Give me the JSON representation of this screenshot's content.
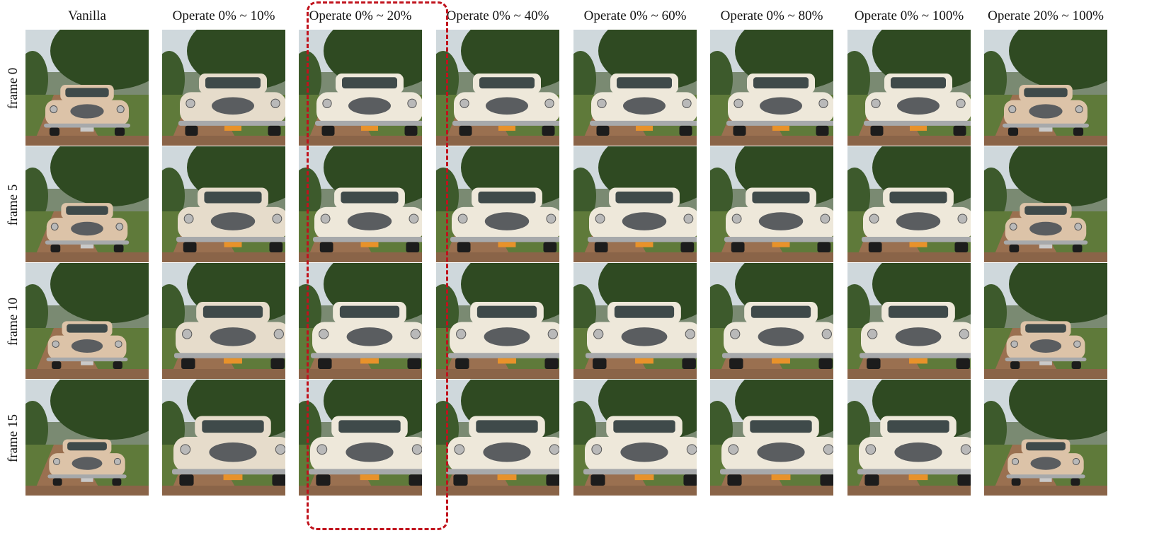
{
  "columns": [
    {
      "label": "Vanilla",
      "style": "beige"
    },
    {
      "label": "Operate 0% ~ 10%",
      "style": "beige-white"
    },
    {
      "label": "Operate 0% ~ 20%",
      "style": "white"
    },
    {
      "label": "Operate 0% ~ 40%",
      "style": "white"
    },
    {
      "label": "Operate 0% ~ 60%",
      "style": "white"
    },
    {
      "label": "Operate 0% ~ 80%",
      "style": "white"
    },
    {
      "label": "Operate 0% ~ 100%",
      "style": "white"
    },
    {
      "label": "Operate 20% ~ 100%",
      "style": "beige"
    }
  ],
  "rows": [
    {
      "label": "frame 0"
    },
    {
      "label": "frame 5"
    },
    {
      "label": "frame 10"
    },
    {
      "label": "frame 15"
    }
  ],
  "highlight": {
    "column": 2,
    "color": "#c0121c"
  },
  "colors": {
    "beige_body": "#dcc3a8",
    "white_body": "#eee8da",
    "sky": "#cfd8dc",
    "trees": "#2f4a22",
    "grass": "#5f7a3a",
    "road": "#9a7050",
    "plate_orange": "#e8922a",
    "plate_silver": "#c9c9c9"
  }
}
